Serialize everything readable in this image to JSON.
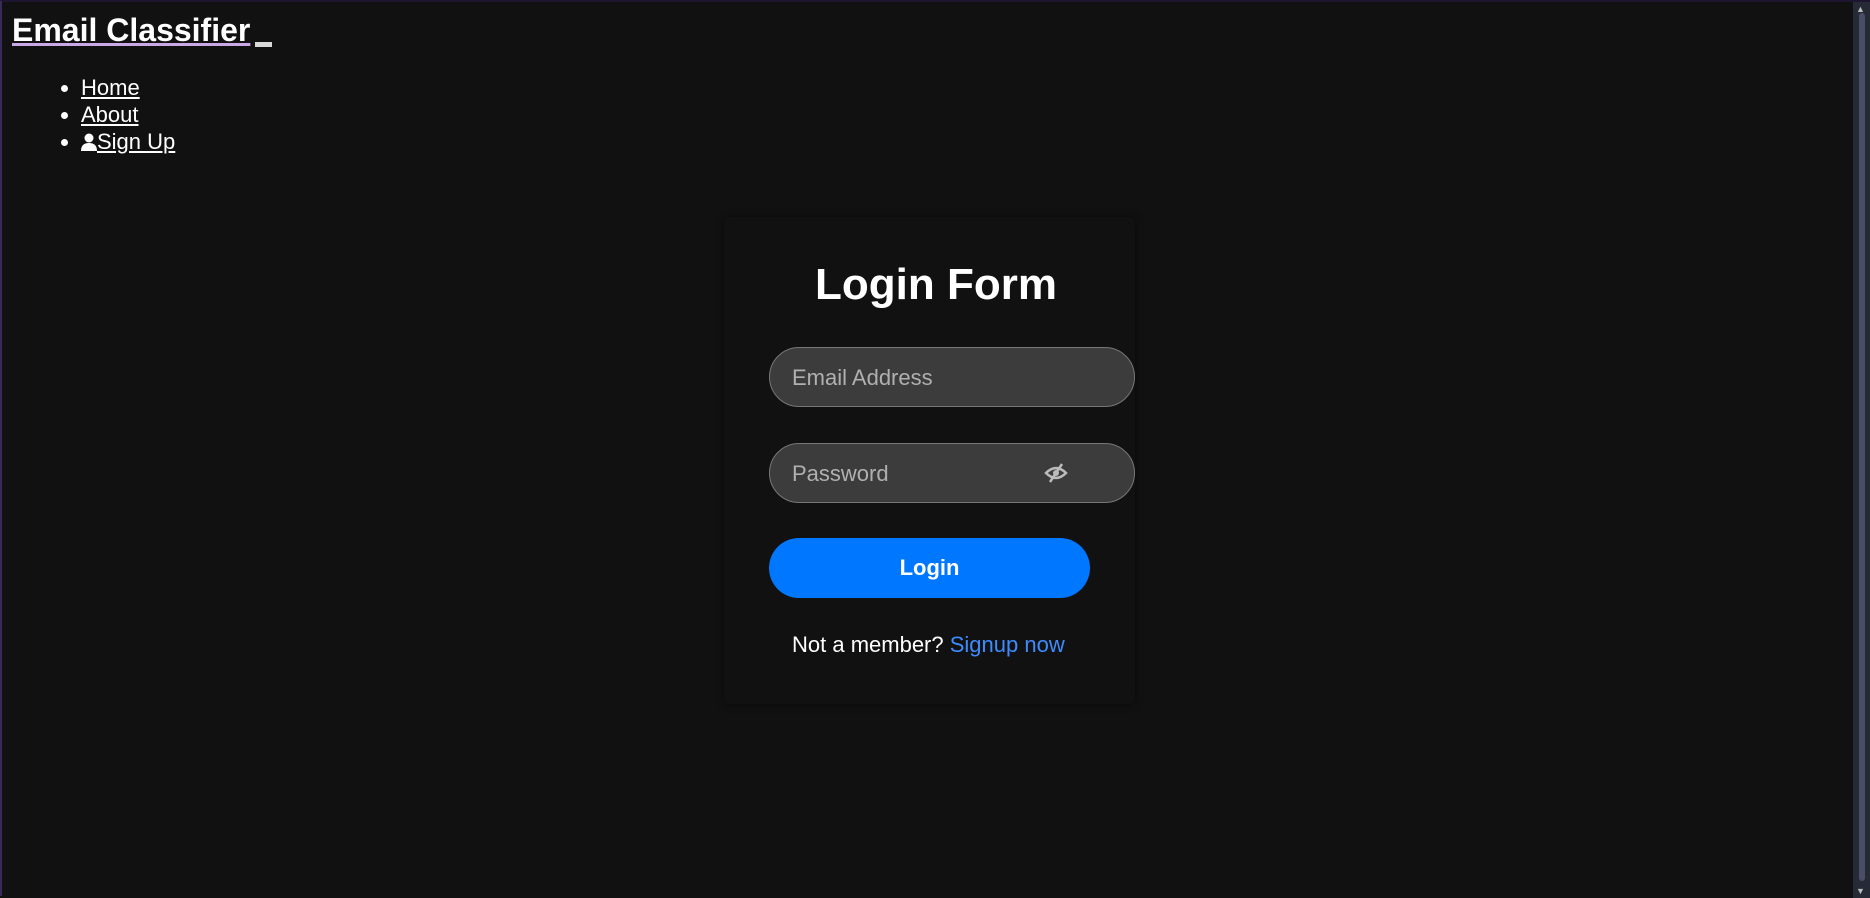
{
  "header": {
    "brand": "Email Classifier"
  },
  "nav": {
    "items": [
      {
        "label": "Home"
      },
      {
        "label": "About"
      },
      {
        "label": "Sign Up",
        "icon": "user-icon"
      }
    ]
  },
  "form": {
    "title": "Login Form",
    "email_placeholder": "Email Address",
    "password_placeholder": "Password",
    "login_label": "Login",
    "signup_prompt": "Not a member?",
    "signup_link": "Signup now"
  },
  "colors": {
    "accent": "#0077ff",
    "link": "#3d8bff",
    "background": "#111111",
    "input_bg": "#3c3c3c"
  }
}
